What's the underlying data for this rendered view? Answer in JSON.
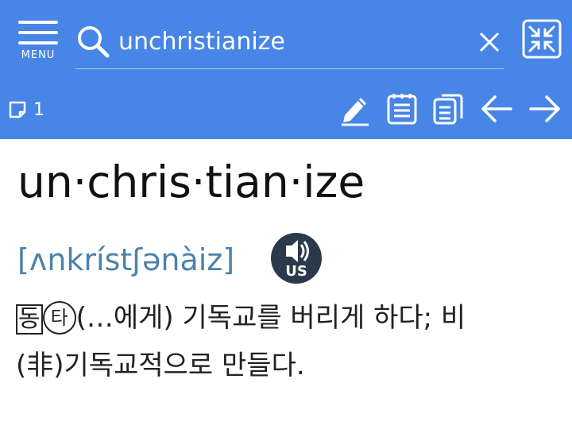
{
  "header": {
    "menu_label": "MENU",
    "search": {
      "value": "unchristianize"
    },
    "note_count": "1"
  },
  "toolbar": {
    "icons": [
      "pencil-icon",
      "notepad-icon",
      "copy-icon",
      "back-arrow-icon",
      "forward-arrow-icon"
    ]
  },
  "entry": {
    "headword": "un·chris·tian·ize",
    "pronunciation": "[ʌnkrístʃənàiz]",
    "audio_label": "US",
    "pos_mark": "동",
    "transitivity_mark": "타",
    "definition_line1": "(…에게) 기독교를 버리게 하다; 비",
    "definition_line2": "(非)기독교적으로 만들다."
  },
  "colors": {
    "header_bg": "#4785e6",
    "pronunciation": "#4b82ab",
    "audio_button": "#2b3a4a"
  }
}
